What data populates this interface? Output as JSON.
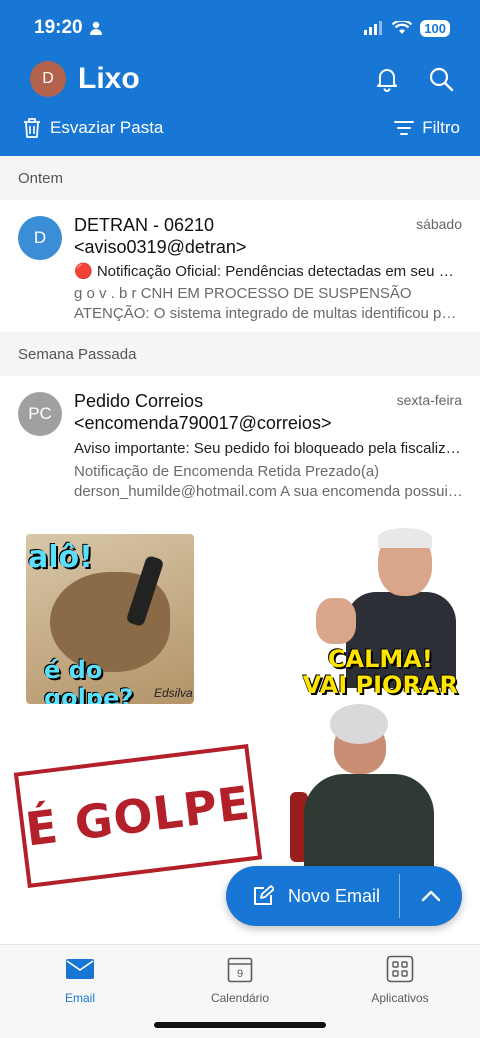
{
  "status_bar": {
    "time": "19:20",
    "battery": "100"
  },
  "header": {
    "avatar_initial": "D",
    "folder_title": "Lixo",
    "empty_folder_label": "Esvaziar Pasta",
    "filter_label": "Filtro"
  },
  "sections": [
    {
      "label": "Ontem"
    },
    {
      "label": "Semana Passada"
    }
  ],
  "emails": [
    {
      "avatar": "D",
      "avatar_color": "#3b8ed6",
      "sender_line1": "DETRAN - 06210",
      "sender_line2": "<aviso0319@detran>",
      "date": "sábado",
      "subject": "🔴 Notificação Oficial: Pendências detectadas em seu CNH",
      "preview_line1": "g o v . b r CNH EM PROCESSO DE SUSPENSÃO",
      "preview_line2": "ATENÇÃO: O sistema integrado de multas identificou pendências"
    },
    {
      "avatar": "PC",
      "avatar_color": "#a0a0a0",
      "sender_line1": "Pedido Correios",
      "sender_line2": "<encomenda790017@correios>",
      "date": "sexta-feira",
      "subject": "Aviso importante: Seu pedido foi bloqueado pela fiscalização",
      "preview_line1": "Notificação de Encomenda Retida Prezado(a)",
      "preview_line2": "derson_humilde@hotmail.com A sua encomenda possui pendências"
    }
  ],
  "stickers": {
    "alo": "alô!",
    "do_golpe": "é do golpe?",
    "signature": "Edsilva",
    "calma": "CALMA!",
    "vai_piorar": "VAI PIORAR",
    "e_golpe": "É GOLPE"
  },
  "fab": {
    "label": "Novo Email"
  },
  "tabs": [
    {
      "label": "Email",
      "icon": "mail-icon"
    },
    {
      "label": "Calendário",
      "icon": "calendar-icon",
      "day": "9"
    },
    {
      "label": "Aplicativos",
      "icon": "apps-icon"
    }
  ],
  "colors": {
    "brand": "#1877d4",
    "section_bg": "#f5f5f5"
  }
}
